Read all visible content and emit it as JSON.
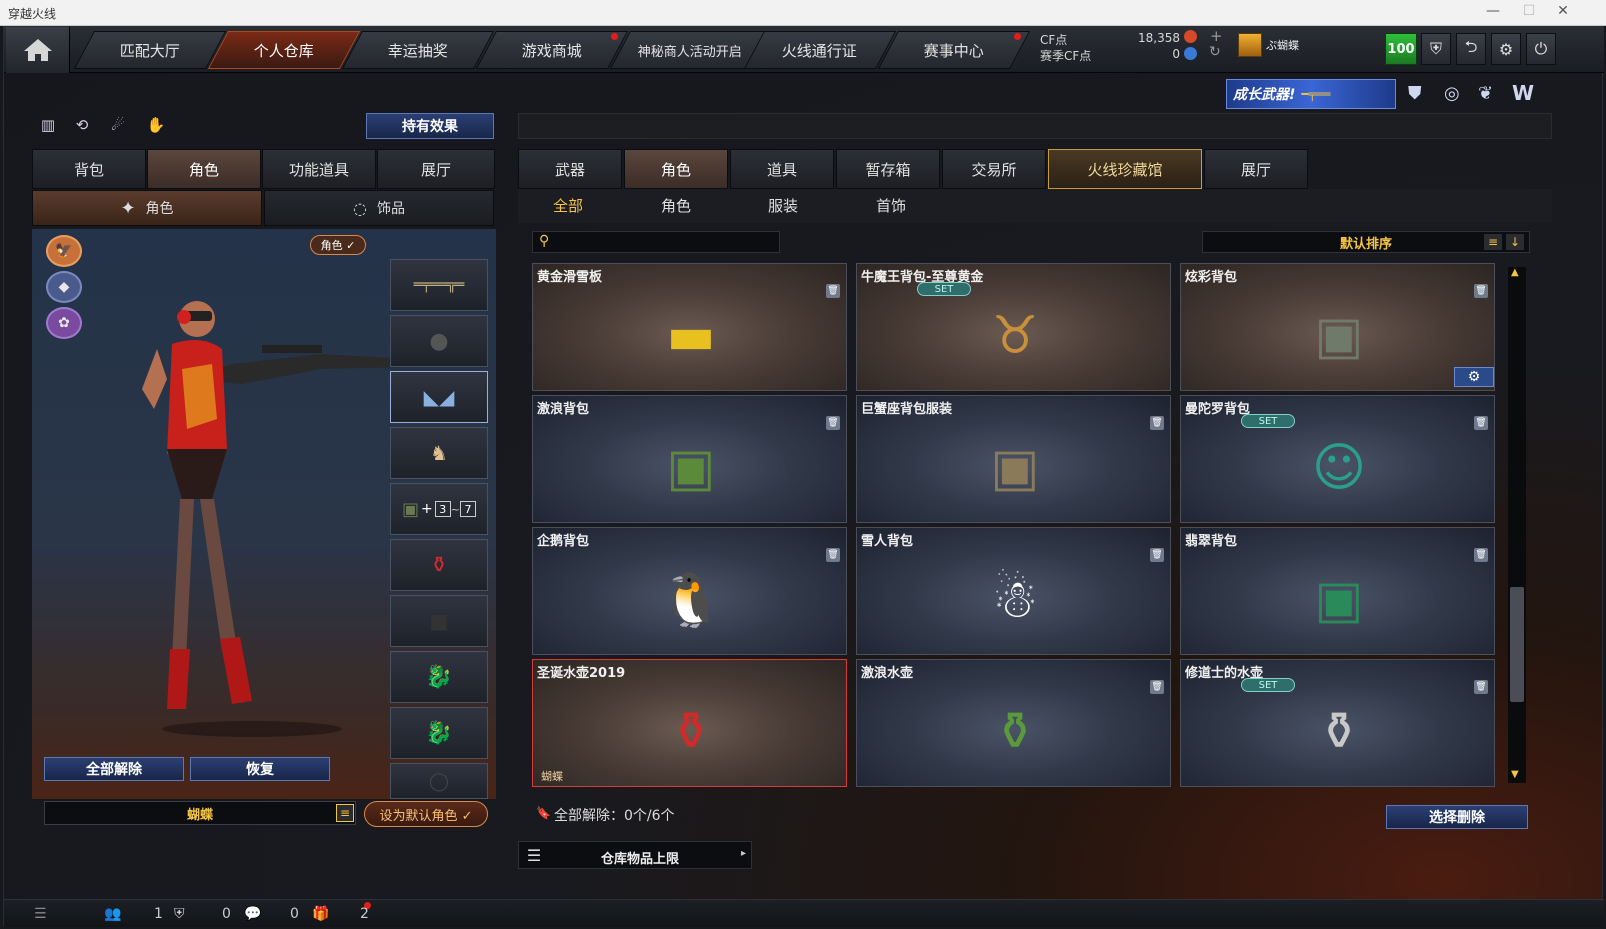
{
  "window": {
    "title": "穿越火线",
    "controls": [
      "—",
      "☐",
      "✕"
    ]
  },
  "nav": {
    "tabs": [
      "匹配大厅",
      "个人仓库",
      "幸运抽奖",
      "游戏商城",
      "神秘商人活动开启",
      "火线通行证",
      "赛事中心"
    ],
    "active_tab": "个人仓库",
    "cf_label": "CF点",
    "cf_value": "18,358",
    "event_cf_label": "赛季CF点",
    "event_cf_value": "0",
    "player_name": "ぷ蝴蝶",
    "level_badge": "100"
  },
  "banner": {
    "text": "成长武器!"
  },
  "left": {
    "hold_effect_button": "持有效果",
    "tabs": [
      "背包",
      "角色",
      "功能道具",
      "展厅"
    ],
    "active_tab": "角色",
    "subtabs": [
      "角色",
      "饰品"
    ],
    "active_subtab": "角色",
    "role_badge": "角色 ✓",
    "slot_badge_3": "3",
    "slot_badge_7": "7",
    "unequip_all": "全部解除",
    "restore": "恢复",
    "character_name": "蝴蝶",
    "set_default": "设为默认角色 ✓"
  },
  "right": {
    "tabs": [
      "武器",
      "角色",
      "道具",
      "暂存箱",
      "交易所",
      "火线珍藏馆",
      "展厅"
    ],
    "active_tab": "角色",
    "category_tabs": [
      "全部",
      "角色",
      "服装",
      "首饰"
    ],
    "active_category": "全部",
    "search_placeholder": "",
    "sort_label": "默认排序",
    "items": [
      {
        "name": "黄金滑雪板",
        "set": "",
        "tag": "",
        "theme": "brown",
        "icon": "gold-snowboard-icon",
        "glyph": "▬",
        "color": "#e8c020"
      },
      {
        "name": "牛魔王背包-至尊黄金",
        "set": "SET",
        "tag": "",
        "theme": "brown",
        "icon": "bull-demon-backpack-icon",
        "glyph": "♉",
        "color": "#c8903a"
      },
      {
        "name": "炫彩背包",
        "set": "",
        "tag": "",
        "theme": "brown",
        "icon": "backpack-icon",
        "glyph": "▣",
        "color": "#707a6a"
      },
      {
        "name": "激浪背包",
        "set": "",
        "tag": "",
        "theme": "blue",
        "icon": "camo-backpack-icon",
        "glyph": "▣",
        "color": "#5a8a3a"
      },
      {
        "name": "巨蟹座背包服装",
        "set": "",
        "tag": "",
        "theme": "blue",
        "icon": "crab-backpack-icon",
        "glyph": "▣",
        "color": "#8a7a5a"
      },
      {
        "name": "曼陀罗背包",
        "set": "SET",
        "tag": "",
        "theme": "blue",
        "icon": "doll-backpack-icon",
        "glyph": "☺",
        "color": "#2aa08a"
      },
      {
        "name": "企鹅背包",
        "set": "",
        "tag": "",
        "theme": "blue",
        "icon": "penguin-backpack-icon",
        "glyph": "🐧",
        "color": "#e0e0e0"
      },
      {
        "name": "雪人背包",
        "set": "",
        "tag": "",
        "theme": "blue",
        "icon": "snowman-backpack-icon",
        "glyph": "☃",
        "color": "#ffffff"
      },
      {
        "name": "翡翠背包",
        "set": "",
        "tag": "",
        "theme": "blue",
        "icon": "jade-backpack-icon",
        "glyph": "▣",
        "color": "#2a8a5a"
      },
      {
        "name": "圣诞水壶2019",
        "set": "",
        "tag": "蝴蝶",
        "theme": "brown",
        "icon": "christmas-kettle-icon",
        "glyph": "⚱",
        "color": "#d02a2a"
      },
      {
        "name": "激浪水壶",
        "set": "",
        "tag": "",
        "theme": "blue",
        "icon": "camo-kettle-icon",
        "glyph": "⚱",
        "color": "#5a9a3a"
      },
      {
        "name": "修道士的水壶",
        "set": "SET",
        "tag": "",
        "theme": "blue",
        "icon": "monk-kettle-icon",
        "glyph": "⚱",
        "color": "#c8c8c8"
      }
    ],
    "release_all_text": "全部解除：0个/6个",
    "select_delete": "选择删除",
    "warehouse_limit": "仓库物品上限"
  },
  "status": {
    "count1": "1",
    "count2": "0",
    "count3": "0",
    "count4": "2"
  }
}
